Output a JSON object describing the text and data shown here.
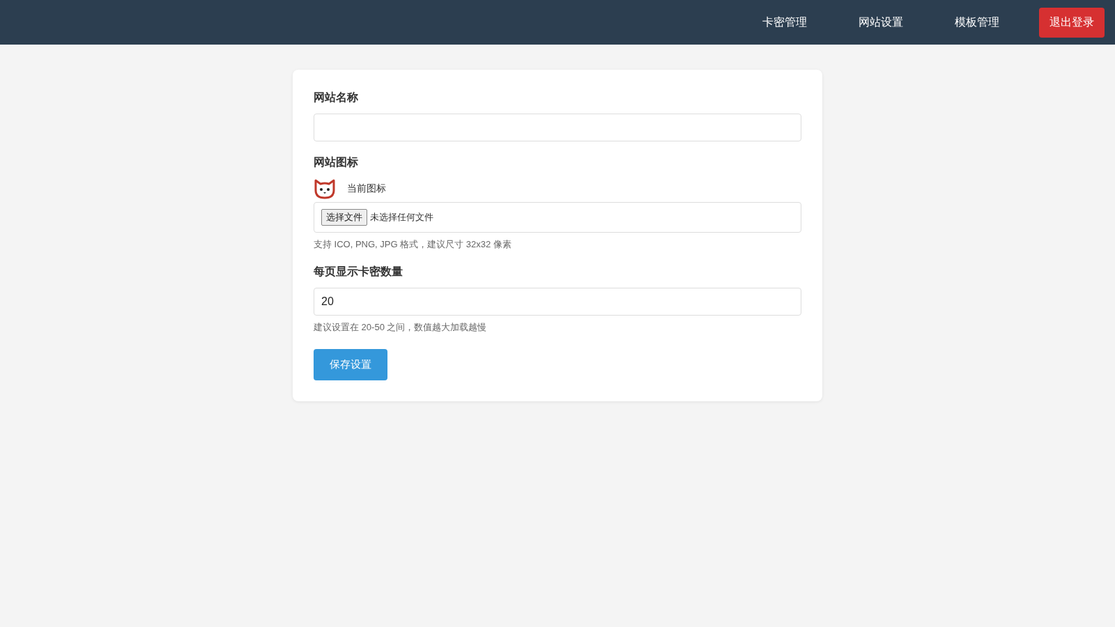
{
  "nav": {
    "links": [
      {
        "label": "卡密管理"
      },
      {
        "label": "网站设置"
      },
      {
        "label": "模板管理"
      }
    ],
    "logout": "退出登录"
  },
  "form": {
    "fields": [
      {
        "kind": "text",
        "label": "网站名称"
      },
      {
        "kind": "file",
        "label": "网站图标",
        "current_label": "当前图标",
        "button": "选择文件",
        "status": "未选择任何文件",
        "hint": "支持 ICO, PNG, JPG 格式，建议尺寸 32x32 像素"
      },
      {
        "kind": "number",
        "label": "每页显示卡密数量",
        "value": "20",
        "hint": "建议设置在 20-50 之间，数值越大加载越慢"
      }
    ],
    "submit": "保存设置"
  }
}
